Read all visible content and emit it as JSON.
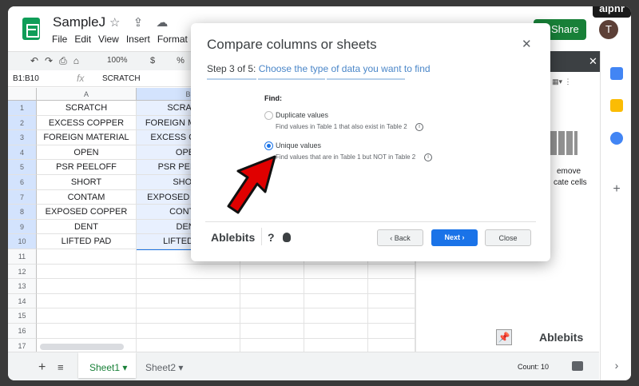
{
  "watermark": "alphr",
  "doc": {
    "title": "SampleJ",
    "menu": [
      "File",
      "Edit",
      "View",
      "Insert",
      "Format"
    ],
    "share_label": "Share",
    "avatar_initial": "T"
  },
  "toolbar": {
    "zoom": "100%",
    "format_symbols": "$ % .0"
  },
  "formula_bar": {
    "name_box": "B1:B10",
    "fx_symbol": "fx",
    "value": "SCRATCH"
  },
  "grid": {
    "columns": [
      "A",
      "B"
    ],
    "row_numbers": [
      "1",
      "2",
      "3",
      "4",
      "5",
      "6",
      "7",
      "8",
      "9",
      "10",
      "11",
      "12",
      "13",
      "14",
      "15",
      "16",
      "17"
    ],
    "col_a": [
      "SCRATCH",
      "EXCESS COPPER",
      "FOREIGN MATERIAL",
      "OPEN",
      "PSR PEELOFF",
      "SHORT",
      "CONTAM",
      "EXPOSED COPPER",
      "DENT",
      "LIFTED PAD"
    ],
    "col_b": [
      "SCRATCH",
      "FOREIGN MATERIAL",
      "EXCESS COPPER",
      "OPEN",
      "PSR PEELOFF",
      "SHORT",
      "EXPOSED COPPER",
      "CONTAM",
      "DENT",
      "LIFTED PAD"
    ]
  },
  "sheets": {
    "add_icon": "+",
    "list_icon": "≡",
    "tabs": [
      "Sheet1 ▾",
      "Sheet2 ▾"
    ],
    "count": "Count: 10"
  },
  "side_panel": {
    "close_icon": "✕",
    "text_line1": "emove",
    "text_line2": "cate cells",
    "brand": "Ablebits"
  },
  "dialog": {
    "title": "Compare columns or sheets",
    "close_icon": "✕",
    "step_prefix": "Step 3 of 5:",
    "step_text": "Choose the type of data you want to find",
    "find_label": "Find:",
    "options": [
      {
        "label": "Duplicate values",
        "desc": "Find values in Table 1 that also exist in Table 2",
        "selected": false
      },
      {
        "label": "Unique values",
        "desc": "Find values that are in Table 1 but NOT in Table 2",
        "selected": true
      }
    ],
    "info_icon": "i",
    "brand": "Ablebits",
    "help_icon": "?",
    "back_label": "‹ Back",
    "next_label": "Next ›",
    "close_label": "Close"
  },
  "colors": {
    "accent": "#1a73e8",
    "share": "#188038",
    "arrow": "#e00000"
  }
}
